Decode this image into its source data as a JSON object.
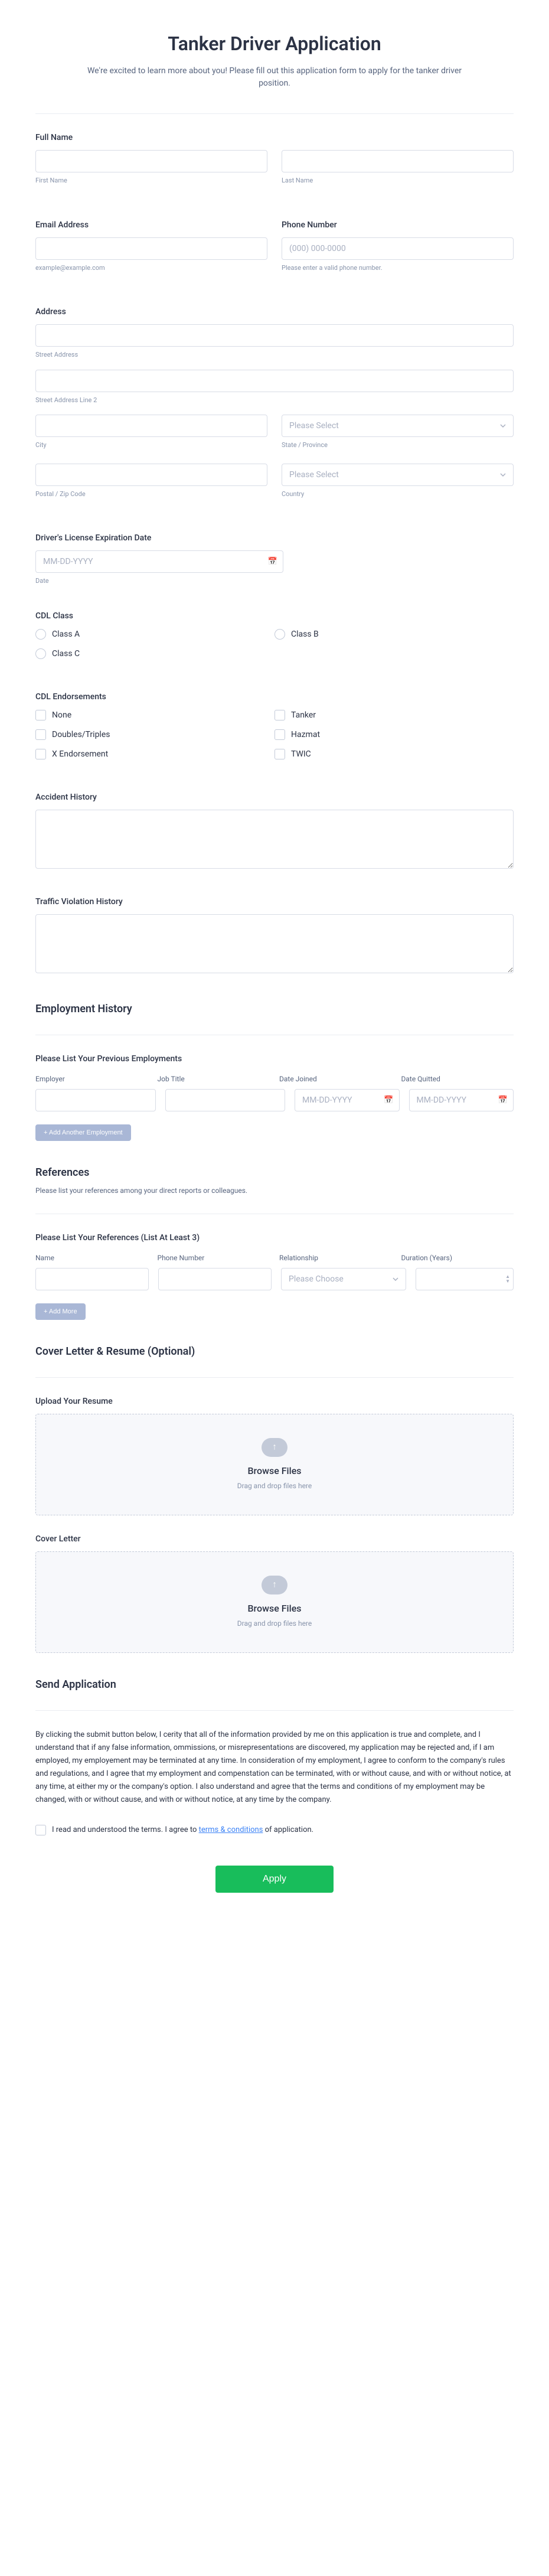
{
  "header": {
    "title": "Tanker Driver Application",
    "subtitle": "We're excited to learn more about you! Please fill out this application form to apply for the tanker driver position."
  },
  "name": {
    "label": "Full Name",
    "first_sub": "First Name",
    "last_sub": "Last Name"
  },
  "email": {
    "label": "Email Address",
    "sub": "example@example.com"
  },
  "phone": {
    "label": "Phone Number",
    "placeholder": "(000) 000-0000",
    "sub": "Please enter a valid phone number."
  },
  "address": {
    "label": "Address",
    "street_sub": "Street Address",
    "street2_sub": "Street Address Line 2",
    "city_sub": "City",
    "state_sub": "State / Province",
    "state_placeholder": "Please Select",
    "postal_sub": "Postal / Zip Code",
    "country_sub": "Country",
    "country_placeholder": "Please Select"
  },
  "license": {
    "label": "Driver's License Expiration Date",
    "placeholder": "MM-DD-YYYY",
    "sub": "Date"
  },
  "cdl_class": {
    "label": "CDL Class",
    "options": [
      "Class A",
      "Class B",
      "Class C"
    ]
  },
  "cdl_end": {
    "label": "CDL Endorsements",
    "options": [
      "None",
      "Tanker",
      "Doubles/Triples",
      "Hazmat",
      "X Endorsement",
      "TWIC"
    ]
  },
  "accident": {
    "label": "Accident History"
  },
  "violation": {
    "label": "Traffic Violation History"
  },
  "employment": {
    "heading": "Employment History",
    "repeater_title": "Please List Your Previous Employments",
    "cols": [
      "Employer",
      "Job Title",
      "Date Joined",
      "Date Quitted"
    ],
    "date_placeholder": "MM-DD-YYYY",
    "add": "+ Add Another Employment"
  },
  "references": {
    "heading": "References",
    "sub": "Please list your references among your direct reports or colleagues.",
    "repeater_title": "Please List Your References (List At Least 3)",
    "cols": [
      "Name",
      "Phone Number",
      "Relationship",
      "Duration (Years)"
    ],
    "rel_placeholder": "Please Choose",
    "add": "+ Add More"
  },
  "docs": {
    "heading": "Cover Letter & Resume (Optional)",
    "resume_label": "Upload Your Resume",
    "cover_label": "Cover Letter",
    "browse": "Browse Files",
    "drag": "Drag and drop files here"
  },
  "send": {
    "heading": "Send Application",
    "legal": "By clicking the submit button below, I cerity that all of the information provided by me on this application is true and complete, and I understand that if any false information, ommissions, or misrepresentations are discovered, my application may be rejected and, if I am employed, my employement may be terminated at any time. In consideration of my employment, I agree to conform to the company's rules and regulations, and I agree that my employment and compenstation can be terminated, with or without cause, and with or without notice, at any time, at either my or the company's option. I also understand and agree that the terms and conditions of my employment may be changed, with or without cause, and with or without notice, at any time by the company.",
    "agree_prefix": "I read and understood the terms. I agree to ",
    "agree_link": "terms & conditions",
    "agree_suffix": " of application."
  },
  "submit_label": "Apply"
}
